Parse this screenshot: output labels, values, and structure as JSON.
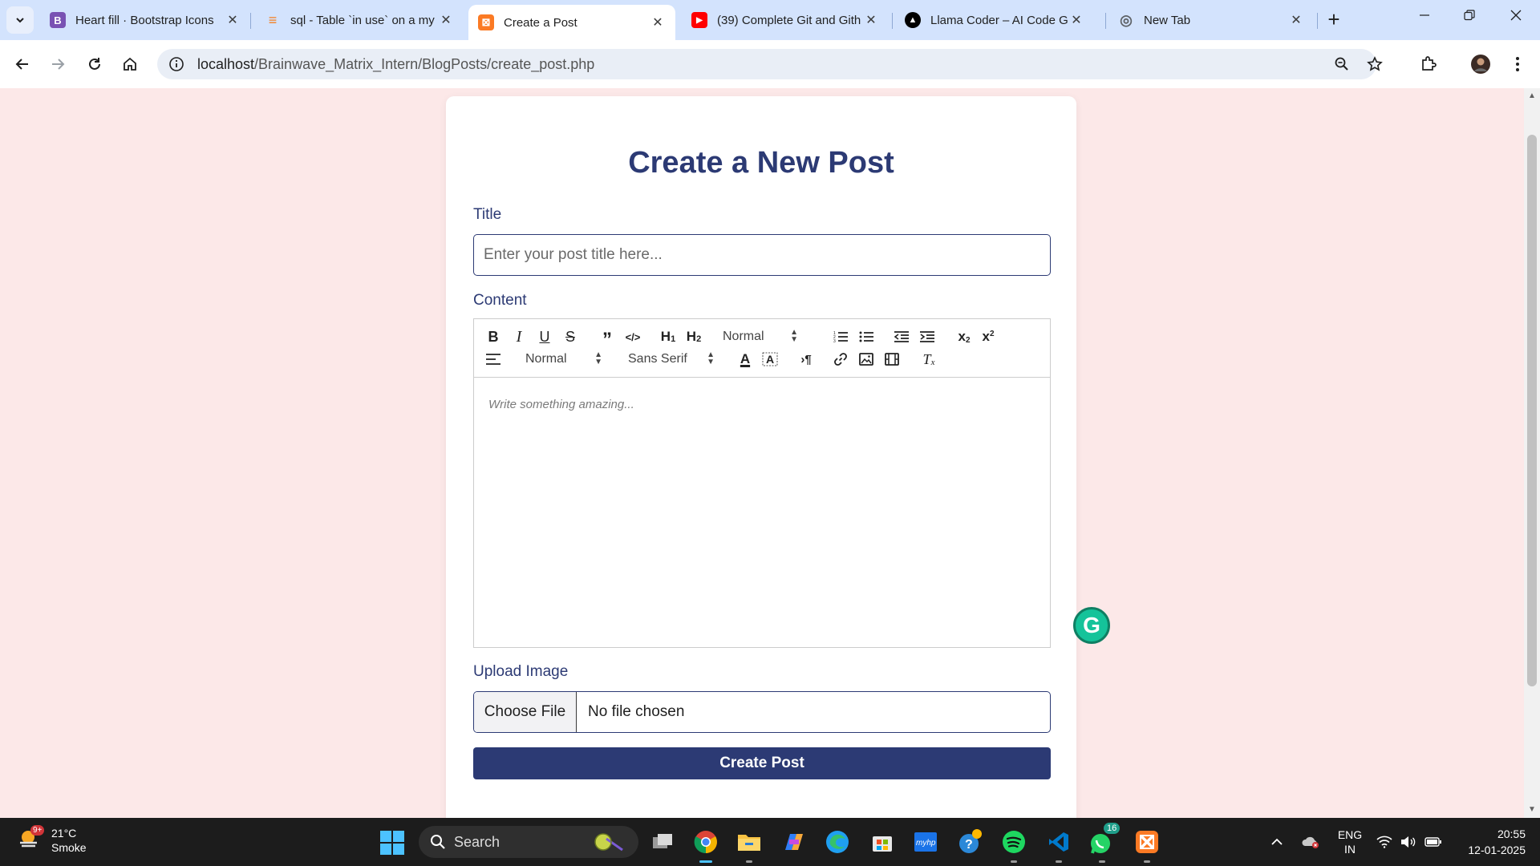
{
  "browser": {
    "tabs": [
      {
        "title": "Heart fill · Bootstrap Icons",
        "favicon": "bootstrap-icon",
        "fav_text": "B",
        "fav_color": "#7952b3"
      },
      {
        "title": "sql - Table `in use` on a my",
        "favicon": "stackoverflow-icon",
        "fav_text": "≡",
        "fav_color": "#f48024"
      },
      {
        "title": "Create a Post",
        "favicon": "xampp-icon",
        "fav_text": "⊠",
        "fav_color": "#fb7a24",
        "active": true
      },
      {
        "title": "(39) Complete Git and Gith",
        "favicon": "youtube-icon",
        "fav_text": "▶",
        "fav_color": "#ff0000"
      },
      {
        "title": "Llama Coder – AI Code Ger",
        "favicon": "llama-coder-icon",
        "fav_text": "▲",
        "fav_color": "#000000"
      },
      {
        "title": "New Tab",
        "favicon": "chrome-icon",
        "fav_text": "◎",
        "fav_color": "#5f6368"
      }
    ],
    "address": {
      "host": "localhost",
      "path": "/Brainwave_Matrix_Intern/BlogPosts/create_post.php"
    }
  },
  "form": {
    "heading": "Create a New Post",
    "title_label": "Title",
    "title_placeholder": "Enter your post title here...",
    "content_label": "Content",
    "editor_placeholder": "Write something amazing...",
    "toolbar": {
      "header_select": "Normal",
      "size_select": "Normal",
      "font_select": "Sans Serif"
    },
    "upload_label": "Upload Image",
    "choose_file": "Choose File",
    "file_status": "No file chosen",
    "submit": "Create Post"
  },
  "taskbar": {
    "weather_temp": "21°C",
    "weather_desc": "Smoke",
    "weather_badge": "9+",
    "search": "Search",
    "whatsapp_badge": "16",
    "lang": "ENG",
    "region": "IN",
    "time": "20:55",
    "date": "12-01-2025"
  },
  "colors": {
    "accent": "#2c3a74",
    "page_bg": "#fce8e8",
    "tabstrip_bg": "#d3e3fd"
  }
}
